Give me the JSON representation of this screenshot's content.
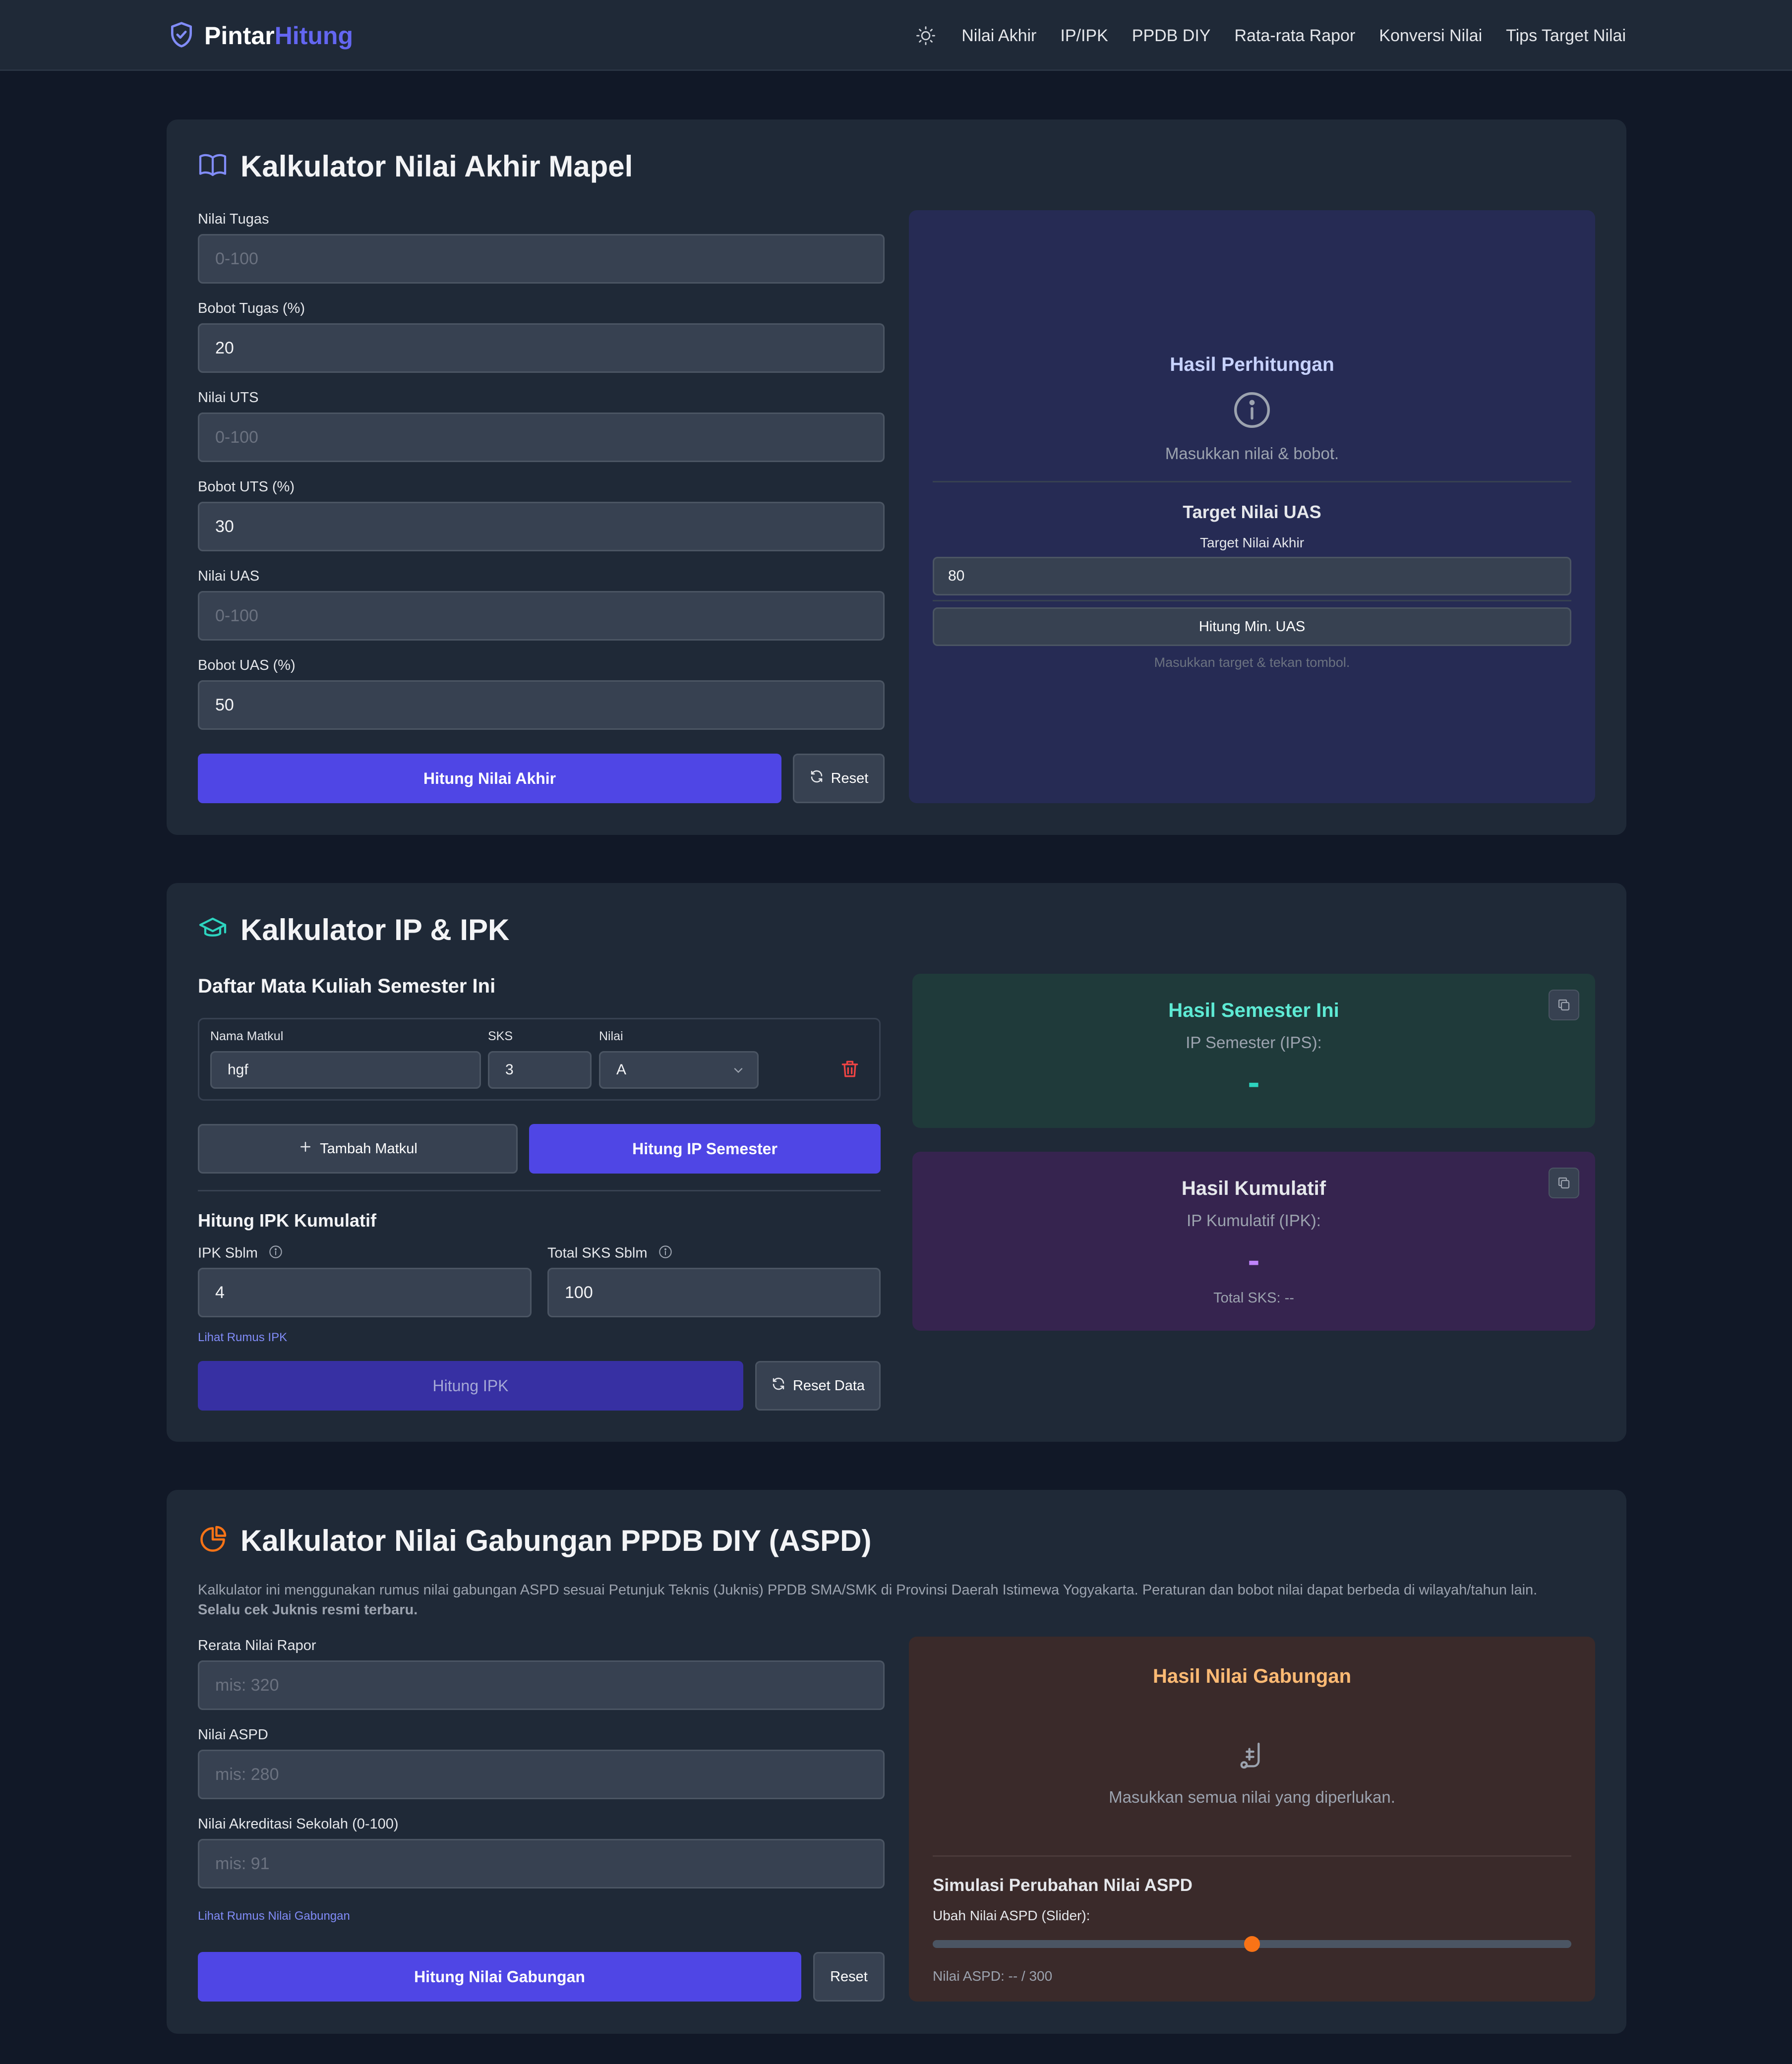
{
  "nav": {
    "brand_part1": "Pintar",
    "brand_part2": "Hitung",
    "theme_icon": "sun-icon",
    "links": [
      "Nilai Akhir",
      "IP/IPK",
      "PPDB DIY",
      "Rata-rata Rapor",
      "Konversi Nilai",
      "Tips Target Nilai"
    ]
  },
  "colors": {
    "background": "#111827",
    "card": "#1f2937",
    "accent": "#4f46e5",
    "input": "#374151"
  },
  "final_grade": {
    "title": "Kalkulator Nilai Akhir Mapel",
    "fields": [
      {
        "label": "Nilai Tugas",
        "value": "",
        "placeholder": "0-100"
      },
      {
        "label": "Bobot Tugas (%)",
        "value": "20",
        "placeholder": ""
      },
      {
        "label": "Nilai UTS",
        "value": "",
        "placeholder": "0-100"
      },
      {
        "label": "Bobot UTS (%)",
        "value": "30",
        "placeholder": ""
      },
      {
        "label": "Nilai UAS",
        "value": "",
        "placeholder": "0-100"
      },
      {
        "label": "Bobot UAS (%)",
        "value": "50",
        "placeholder": ""
      }
    ],
    "calculate_label": "Hitung Nilai Akhir",
    "reset_label": "Reset",
    "result_title": "Hasil Perhitungan",
    "result_message": "Masukkan nilai & bobot.",
    "target_title": "Target Nilai UAS",
    "target_label": "Target Nilai Akhir",
    "target_value": "80",
    "target_button": "Hitung Min. UAS",
    "target_hint": "Masukkan target & tekan tombol."
  },
  "ipk": {
    "title": "Kalkulator IP & IPK",
    "semester_heading": "Daftar Mata Kuliah Semester Ini",
    "course_columns": [
      "Nama Matkul",
      "SKS",
      "Nilai"
    ],
    "course_row": {
      "name": "hgf",
      "sks": "3",
      "grade": "A"
    },
    "add_button": "Tambah Matkul",
    "calc_semester_button": "Hitung IP Semester",
    "cumulative_heading": "Hitung IPK Kumulatif",
    "prev_ipk_label": "IPK Sblm",
    "prev_ipk_value": "4",
    "prev_sks_label": "Total SKS Sblm",
    "prev_sks_value": "100",
    "formula_link": "Lihat Rumus IPK",
    "calc_ipk_button": "Hitung IPK",
    "reset_button": "Reset Data",
    "semester_result_title": "Hasil Semester Ini",
    "semester_result_label": "IP Semester (IPS):",
    "semester_result_value": "-",
    "cumulative_result_title": "Hasil Kumulatif",
    "cumulative_result_label": "IP Kumulatif (IPK):",
    "cumulative_result_value": "-",
    "total_sks_text": "Total SKS: --"
  },
  "ppdb": {
    "title": "Kalkulator Nilai Gabungan PPDB DIY (ASPD)",
    "description": "Kalkulator ini menggunakan rumus nilai gabungan ASPD sesuai Petunjuk Teknis (Juknis) PPDB SMA/SMK di Provinsi Daerah Istimewa Yogyakarta. Peraturan dan bobot nilai dapat berbeda di wilayah/tahun lain.",
    "description_bold": "Selalu cek Juknis resmi terbaru.",
    "fields": [
      {
        "label": "Rerata Nilai Rapor",
        "placeholder": "mis: 320"
      },
      {
        "label": "Nilai ASPD",
        "placeholder": "mis: 280"
      },
      {
        "label": "Nilai Akreditasi Sekolah (0-100)",
        "placeholder": "mis: 91"
      }
    ],
    "formula_link": "Lihat Rumus Nilai Gabungan",
    "calculate_label": "Hitung Nilai Gabungan",
    "reset_label": "Reset",
    "result_title": "Hasil Nilai Gabungan",
    "result_message": "Masukkan semua nilai yang diperlukan.",
    "simulation_title": "Simulasi Perubahan Nilai ASPD",
    "slider_label": "Ubah Nilai ASPD (Slider):",
    "slider_fraction": 0.5,
    "slider_readout": "Nilai ASPD: -- / 300"
  }
}
